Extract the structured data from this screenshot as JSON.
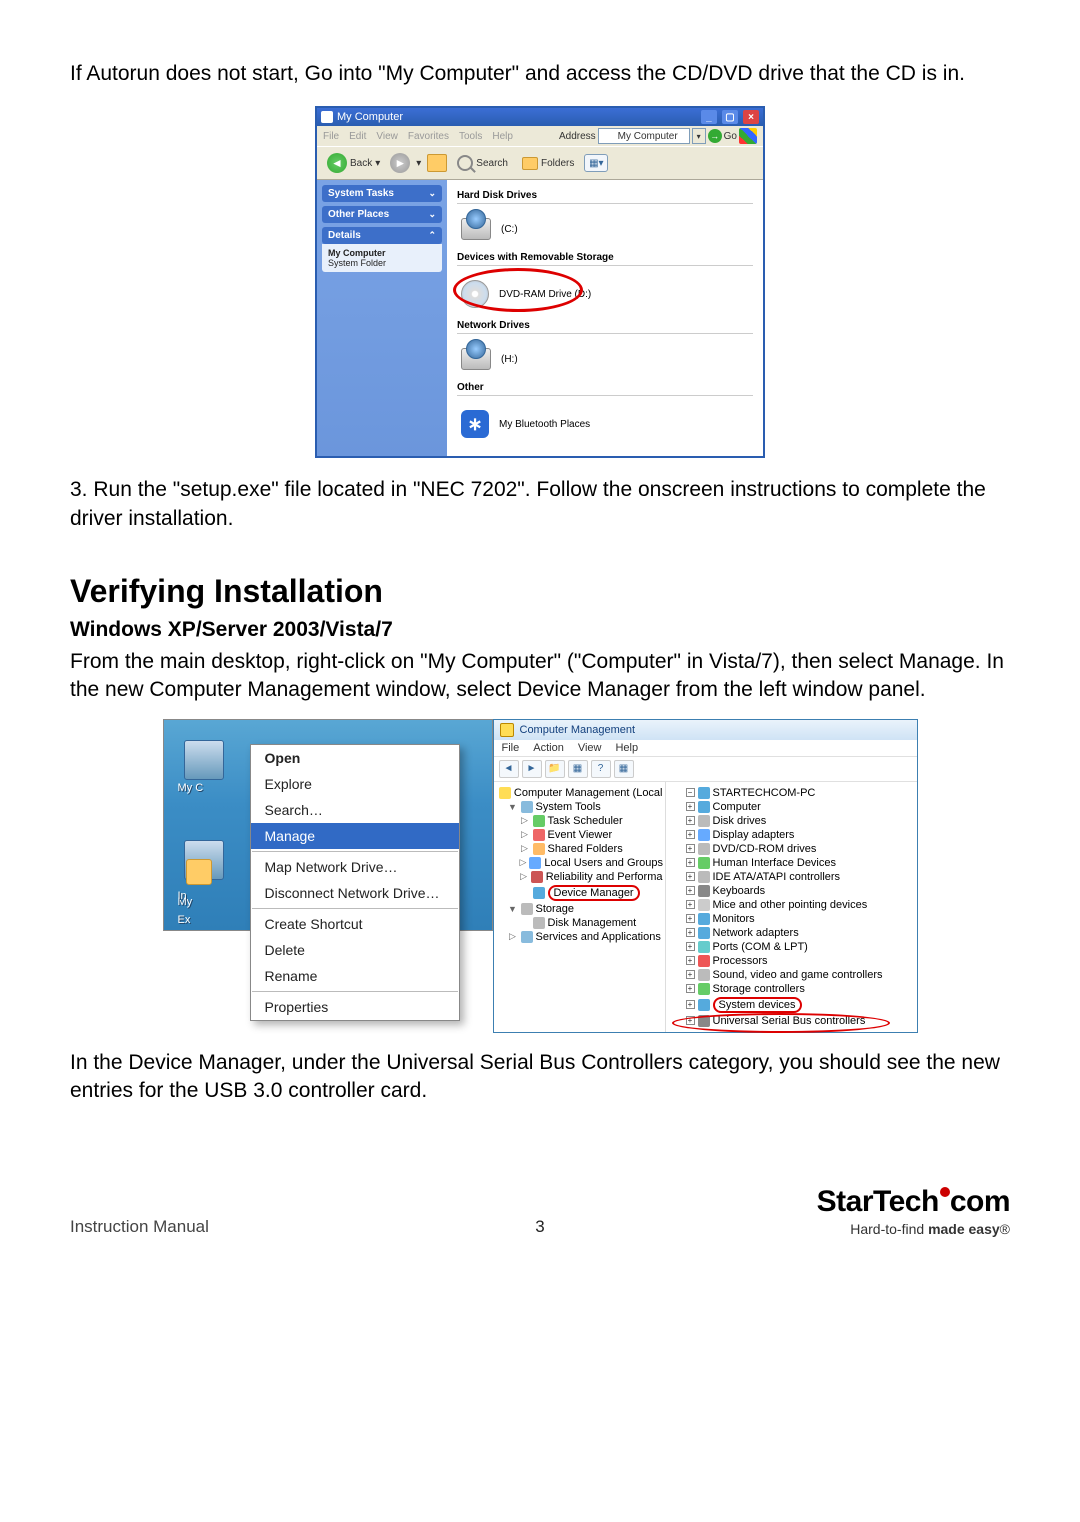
{
  "intro": "If Autorun does not start, Go into \"My Computer\" and access the CD/DVD drive that the CD is in.",
  "step3": "3.  Run the \"setup.exe\" file located in \"NEC 7202\".  Follow the onscreen instructions to complete the driver installation.",
  "section_heading": "Verifying Installation",
  "subsection_heading": "Windows XP/Server 2003/Vista/7",
  "verify_p1": "From the main desktop, right-click on \"My Computer\" (\"Computer\" in Vista/7), then select Manage. In the new Computer Management window, select Device Manager from the left window panel.",
  "verify_p2": "In the Device Manager, under the Universal Serial Bus Controllers category, you should see the new entries for the USB 3.0 controller card.",
  "footer_label": "Instruction Manual",
  "page_number": "3",
  "brand": {
    "name": "StarTech",
    "suffix": "com",
    "tagline_plain": "Hard-to-find ",
    "tagline_bold": "made easy",
    "reg": "®"
  },
  "xp_window": {
    "title": "My Computer",
    "win_buttons": {
      "min": "_",
      "max": "▢",
      "close": "×"
    },
    "menus": [
      "File",
      "Edit",
      "View",
      "Favorites",
      "Tools",
      "Help"
    ],
    "address_label": "Address",
    "address_value": "My Computer",
    "go_label": "Go",
    "toolbar": {
      "back": "Back",
      "search": "Search",
      "folders": "Folders"
    },
    "sidebar": {
      "system_tasks": "System Tasks",
      "other_places": "Other Places",
      "details": "Details",
      "details_title": "My Computer",
      "details_sub": "System Folder"
    },
    "cats": {
      "hard": "Hard Disk Drives",
      "removable": "Devices with Removable Storage",
      "network": "Network Drives",
      "other": "Other"
    },
    "items": {
      "c": "(C:)",
      "dvd": "DVD-RAM Drive (D:)",
      "h": "(H:)",
      "bt": "My Bluetooth Places"
    }
  },
  "context_menu": {
    "label1": "My C",
    "label2": "My",
    "items": [
      {
        "label": "Open",
        "bold": true
      },
      {
        "label": "Explore"
      },
      {
        "label": "Search…"
      },
      {
        "label": "Manage",
        "selected": true
      },
      {
        "sep": true
      },
      {
        "label": "Map Network Drive…"
      },
      {
        "label": "Disconnect Network Drive…"
      },
      {
        "sep": true
      },
      {
        "label": "Create Shortcut"
      },
      {
        "label": "Delete"
      },
      {
        "label": "Rename"
      },
      {
        "sep": true
      },
      {
        "label": "Properties"
      }
    ],
    "small_labels": [
      "In",
      "Ex"
    ]
  },
  "cm_window": {
    "title": "Computer Management",
    "menus": [
      "File",
      "Action",
      "View",
      "Help"
    ],
    "tb_icons": [
      "◄",
      "►",
      "📁",
      "▦",
      "?",
      "▦"
    ],
    "left_tree": [
      {
        "ind": 0,
        "exp": "",
        "ico": "#fd5",
        "label": "Computer Management (Local"
      },
      {
        "ind": 1,
        "exp": "▼",
        "ico": "#8bd",
        "label": "System Tools"
      },
      {
        "ind": 2,
        "exp": "▷",
        "ico": "#6c6",
        "label": "Task Scheduler"
      },
      {
        "ind": 2,
        "exp": "▷",
        "ico": "#e66",
        "label": "Event Viewer"
      },
      {
        "ind": 2,
        "exp": "▷",
        "ico": "#fb6",
        "label": "Shared Folders"
      },
      {
        "ind": 2,
        "exp": "▷",
        "ico": "#6af",
        "label": "Local Users and Groups"
      },
      {
        "ind": 2,
        "exp": "▷",
        "ico": "#c55",
        "label": "Reliability and Performa"
      },
      {
        "ind": 2,
        "exp": "",
        "ico": "#5ad",
        "label": "Device Manager",
        "hl": true
      },
      {
        "ind": 1,
        "exp": "▼",
        "ico": "#bbb",
        "label": "Storage"
      },
      {
        "ind": 2,
        "exp": "",
        "ico": "#bbb",
        "label": "Disk Management"
      },
      {
        "ind": 1,
        "exp": "▷",
        "ico": "#8bd",
        "label": "Services and Applications"
      }
    ],
    "right_tree": [
      {
        "exp": "−",
        "ico": "#5ad",
        "label": "STARTECHCOM-PC"
      },
      {
        "exp": "+",
        "ico": "#5ad",
        "label": "Computer"
      },
      {
        "exp": "+",
        "ico": "#bbb",
        "label": "Disk drives"
      },
      {
        "exp": "+",
        "ico": "#6af",
        "label": "Display adapters"
      },
      {
        "exp": "+",
        "ico": "#bbb",
        "label": "DVD/CD-ROM drives"
      },
      {
        "exp": "+",
        "ico": "#6c6",
        "label": "Human Interface Devices"
      },
      {
        "exp": "+",
        "ico": "#bbb",
        "label": "IDE ATA/ATAPI controllers"
      },
      {
        "exp": "+",
        "ico": "#888",
        "label": "Keyboards"
      },
      {
        "exp": "+",
        "ico": "#ccc",
        "label": "Mice and other pointing devices"
      },
      {
        "exp": "+",
        "ico": "#5ad",
        "label": "Monitors"
      },
      {
        "exp": "+",
        "ico": "#5ad",
        "label": "Network adapters"
      },
      {
        "exp": "+",
        "ico": "#6cc",
        "label": "Ports (COM & LPT)"
      },
      {
        "exp": "+",
        "ico": "#e55",
        "label": "Processors"
      },
      {
        "exp": "+",
        "ico": "#bbb",
        "label": "Sound, video and game controllers"
      },
      {
        "exp": "+",
        "ico": "#6c6",
        "label": "Storage controllers"
      },
      {
        "exp": "+",
        "ico": "#5ad",
        "label": "System devices",
        "hl": true
      },
      {
        "exp": "+",
        "ico": "#888",
        "label": "Universal Serial Bus controllers",
        "circ": true
      }
    ]
  }
}
